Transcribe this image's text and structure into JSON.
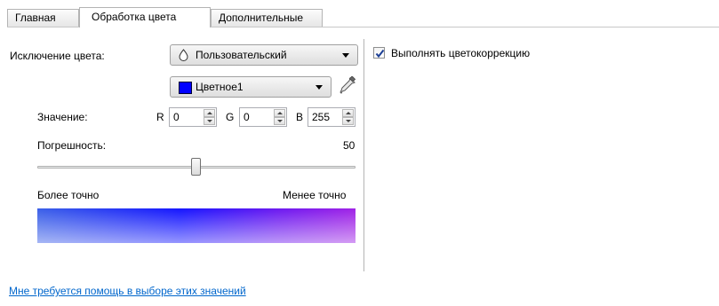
{
  "tabs": [
    {
      "label": "Главная",
      "active": false
    },
    {
      "label": "Обработка цвета",
      "active": true
    },
    {
      "label": "Дополнительные",
      "active": false
    }
  ],
  "color_dropout": {
    "label": "Исключение цвета:",
    "mode_value": "Пользовательский",
    "color_value": "Цветное1",
    "swatch_color": "#0000ff"
  },
  "values": {
    "label": "Значение:",
    "r_label": "R",
    "r_value": "0",
    "g_label": "G",
    "g_value": "0",
    "b_label": "B",
    "b_value": "255"
  },
  "tolerance": {
    "label": "Погрешность:",
    "value": "50",
    "level_percent": 50,
    "min_label": "Более точно",
    "max_label": "Менее точно"
  },
  "color_correction": {
    "label": "Выполнять цветокоррекцию",
    "checked": true
  },
  "help_link": "Мне требуется помощь в выборе этих значений",
  "icons": [
    "drop-icon",
    "eyedropper-icon",
    "chevron-down-icon",
    "checkmark-icon"
  ],
  "colors": {
    "accent": "#0066cc",
    "gradient_start": "#3a5fe8",
    "gradient_mid": "#1515ff",
    "gradient_end": "#a022e6"
  }
}
